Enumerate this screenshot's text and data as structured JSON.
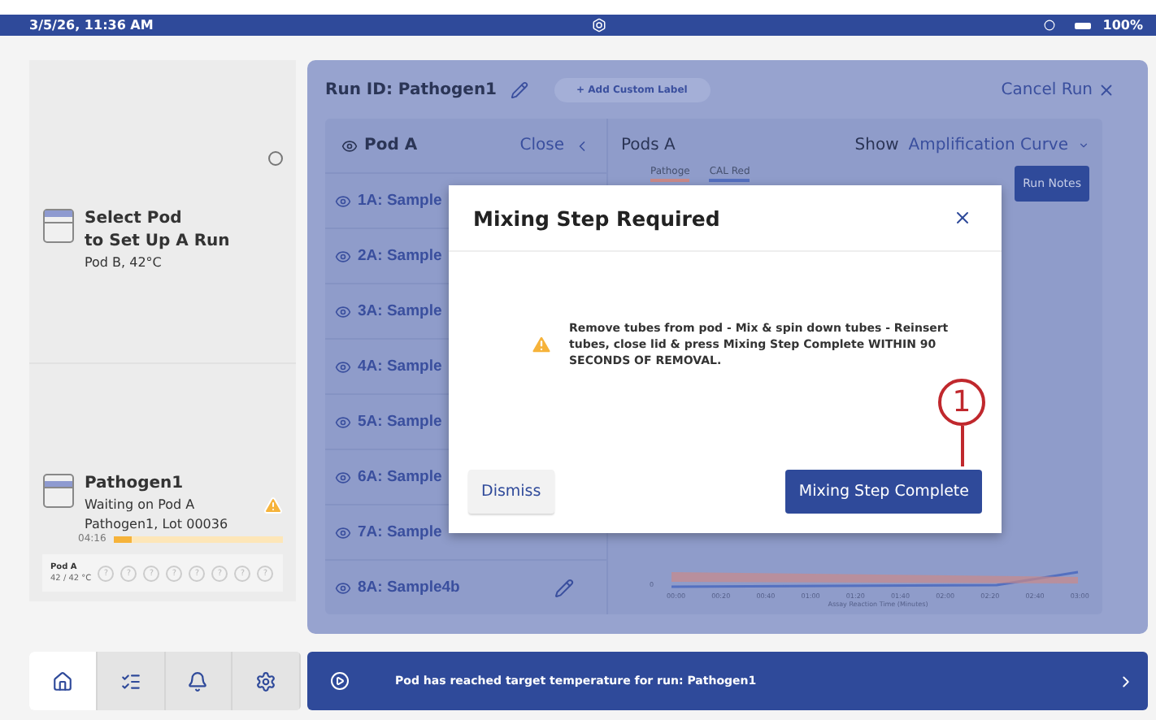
{
  "status_bar": {
    "datetime": "3/5/26, 11:36 AM",
    "battery": "100%"
  },
  "pods": [
    {
      "kind": "setup",
      "title_lines": [
        "Select Pod",
        "to Set Up A Run"
      ],
      "subtitle": "Pod B, 42°C",
      "selected": false
    },
    {
      "kind": "run",
      "title": "Pathogen1",
      "status": "Waiting on Pod A",
      "detail": "Pathogen1, Lot 00036",
      "timer": "04:16",
      "level": 0.1,
      "warning": true,
      "pod_label": "Pod A",
      "temperature": "42 / 42 °C",
      "wells": [
        "?",
        "?",
        "?",
        "?",
        "?",
        "?",
        "?",
        "?"
      ]
    }
  ],
  "run": {
    "run_id": "Run ID: Pathogen1",
    "add_label": "+ Add Custom Label",
    "cancel": "Cancel Run"
  },
  "samples": {
    "title": "Pod A",
    "close": "Close",
    "rows": [
      {
        "label": "1A: Sample",
        "editable": false
      },
      {
        "label": "2A: Sample",
        "editable": false
      },
      {
        "label": "3A: Sample",
        "editable": false
      },
      {
        "label": "4A: Sample",
        "editable": false
      },
      {
        "label": "5A: Sample",
        "editable": false
      },
      {
        "label": "6A: Sample",
        "editable": false
      },
      {
        "label": "7A: Sample",
        "editable": false
      },
      {
        "label": "8A: Sample4b",
        "editable": true
      }
    ]
  },
  "chart": {
    "title": "Pods A",
    "show_label": "Show",
    "show_value": "Amplification Curve",
    "legend": [
      {
        "name": "Pathoge",
        "color": "#c98a8a"
      },
      {
        "name": "CAL Red",
        "color": "#5470c0"
      }
    ],
    "run_notes": "Run Notes",
    "y_tick": "0",
    "x_ticks": [
      "00:00",
      "00:20",
      "00:40",
      "01:00",
      "01:20",
      "01:40",
      "02:00",
      "02:20",
      "02:40",
      "03:00"
    ],
    "xlabel": "Assay Reaction Time (Minutes)"
  },
  "dialog": {
    "title": "Mixing Step Required",
    "message": "Remove tubes from pod - Mix & spin down tubes - Reinsert tubes, close lid & press Mixing Step Complete WITHIN 90 SECONDS OF REMOVAL.",
    "buttons": [
      {
        "kind": "secondary",
        "label": "Dismiss"
      },
      {
        "kind": "primary",
        "label": "Mixing Step Complete"
      }
    ],
    "callout": "1"
  },
  "nav": [
    {
      "kind": "home",
      "selected": true
    },
    {
      "kind": "list",
      "selected": false
    },
    {
      "kind": "bell",
      "selected": false
    },
    {
      "kind": "settings",
      "selected": false
    }
  ],
  "notification": {
    "text": "Pod has reached target temperature for run: Pathogen1"
  }
}
